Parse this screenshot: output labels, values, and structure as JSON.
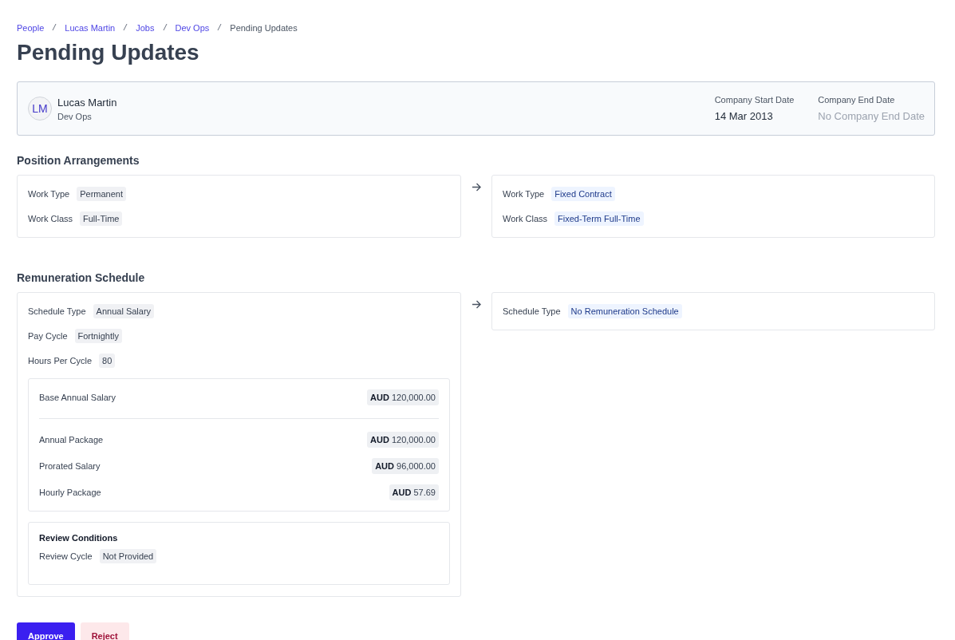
{
  "breadcrumb": [
    {
      "label": "People",
      "kind": "link"
    },
    {
      "label": "Lucas Martin",
      "kind": "link"
    },
    {
      "label": "Jobs",
      "kind": "link"
    },
    {
      "label": "Dev Ops",
      "kind": "link"
    },
    {
      "label": "Pending Updates",
      "kind": "current"
    }
  ],
  "title": "Pending Updates",
  "employee": {
    "initials": "LM",
    "name": "Lucas Martin",
    "department": "Dev Ops",
    "dates": [
      {
        "label": "Company Start Date",
        "value": "14 Mar 2013",
        "kind": "set"
      },
      {
        "label": "Company End Date",
        "value": "No Company End Date",
        "kind": "empty"
      }
    ]
  },
  "sections": [
    {
      "title": "Position Arrangements",
      "current": {
        "fields": [
          {
            "label": "Work Type",
            "value": "Permanent"
          },
          {
            "label": "Work Class",
            "value": "Full-Time"
          }
        ]
      },
      "proposed": {
        "fields": [
          {
            "label": "Work Type",
            "value": "Fixed Contract"
          },
          {
            "label": "Work Class",
            "value": "Fixed-Term Full-Time"
          }
        ]
      }
    },
    {
      "title": "Remuneration Schedule",
      "current": {
        "fields": [
          {
            "label": "Schedule Type",
            "value": "Annual Salary"
          },
          {
            "label": "Pay Cycle",
            "value": "Fortnightly"
          },
          {
            "label": "Hours Per Cycle",
            "value": "80"
          }
        ],
        "salary": {
          "base": {
            "label": "Base Annual Salary",
            "amount": "**AUD** 120,000.00"
          },
          "items": [
            {
              "label": "Annual Package",
              "amount": "**AUD** 120,000.00"
            },
            {
              "label": "Prorated Salary",
              "amount": "**AUD** 96,000.00"
            },
            {
              "label": "Hourly Package",
              "amount": "**AUD** 57.69"
            }
          ]
        },
        "review": {
          "title": "Review Conditions",
          "fields": [
            {
              "label": "Review Cycle",
              "value": "Not Provided"
            }
          ]
        }
      },
      "proposed": {
        "fields": [
          {
            "label": "Schedule Type",
            "value": "No Remuneration Schedule"
          }
        ]
      }
    }
  ],
  "actions": [
    {
      "label": "Approve",
      "kind": "primary"
    },
    {
      "label": "Reject",
      "kind": "danger"
    }
  ]
}
